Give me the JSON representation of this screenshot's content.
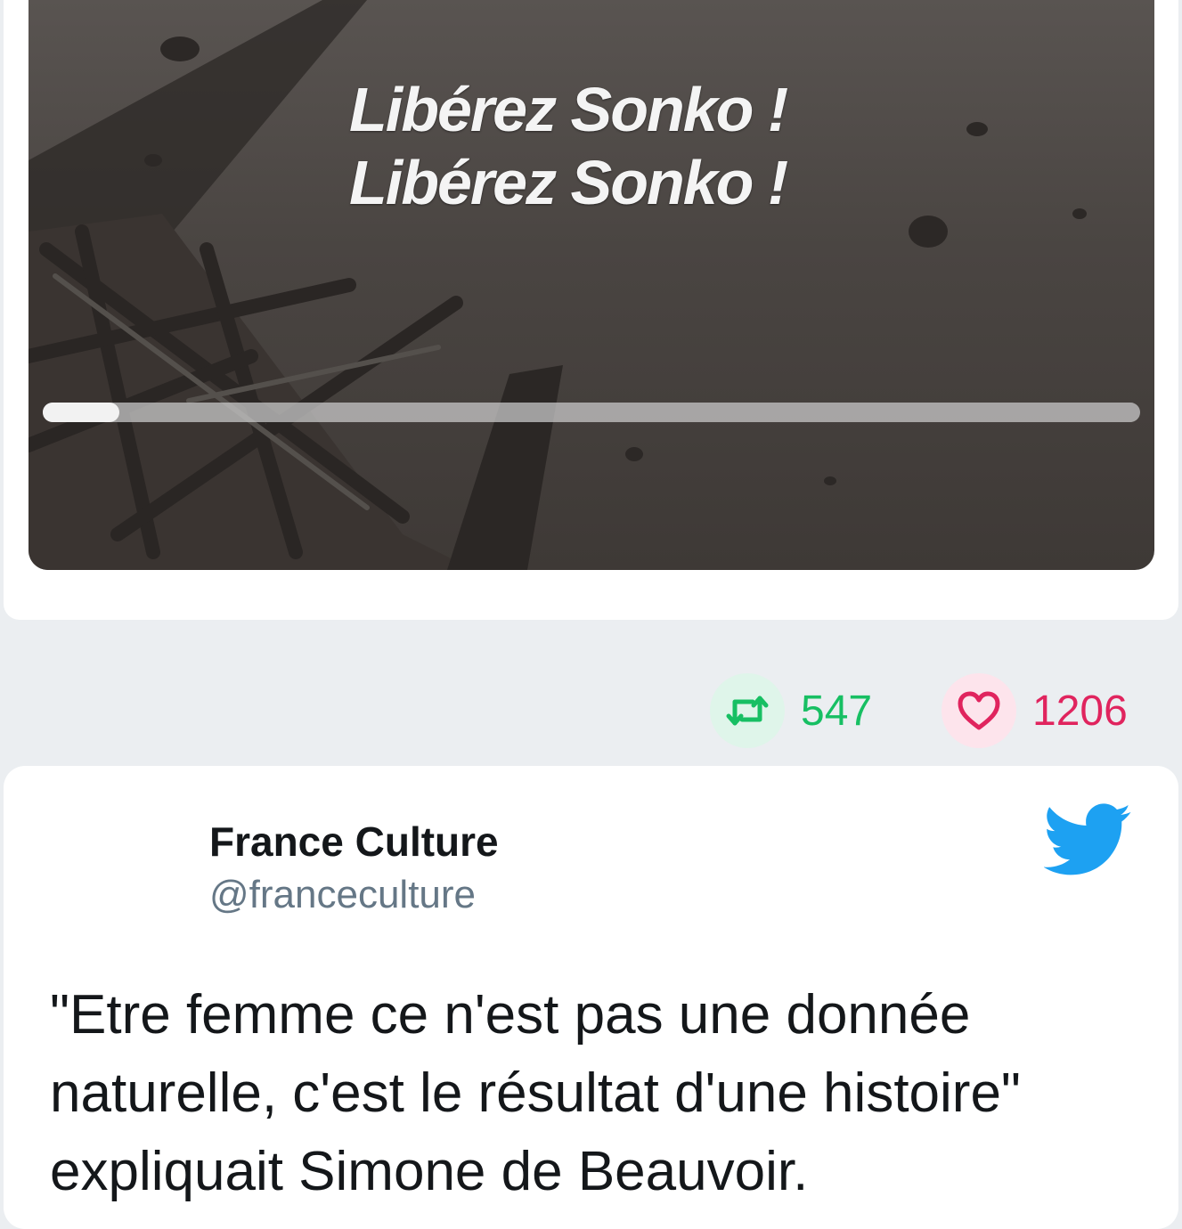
{
  "media": {
    "caption_line1": "Libérez Sonko !",
    "caption_line2": "Libérez Sonko !",
    "progress": 0.07
  },
  "stats": {
    "retweets": "547",
    "likes": "1206",
    "retweet_color": "#17bf63",
    "like_color": "#e0245e"
  },
  "next_tweet": {
    "author_name": "France Culture",
    "author_handle": "@franceculture",
    "text": "\"Etre femme ce n'est pas une donnée naturelle, c'est le résultat d'une histoire\" expliquait Simone de Beauvoir.",
    "icon": "twitter-bird-icon",
    "brand_color": "#1da1f2"
  }
}
